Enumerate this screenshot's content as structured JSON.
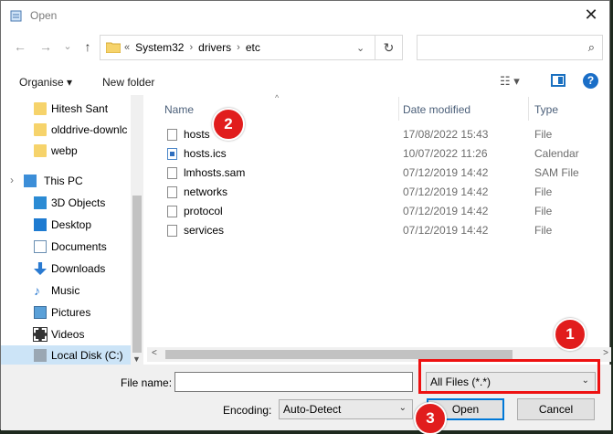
{
  "window": {
    "title": "Open",
    "close_glyph": "✕"
  },
  "nav": {
    "back": "←",
    "forward": "→",
    "dropdown": "⌄",
    "up": "↑"
  },
  "address": {
    "overflow": "«",
    "crumbs": [
      "System32",
      "drivers",
      "etc"
    ],
    "separator": "›",
    "dropdown": "⌄",
    "refresh": "↻"
  },
  "search": {
    "placeholder": "",
    "icon": "⌕"
  },
  "toolbar": {
    "organise": "Organise ▾",
    "new_folder": "New folder",
    "view": "☷ ▾",
    "help": "?"
  },
  "sidebar": {
    "items": [
      {
        "label": "Hitesh Sant",
        "icon": "folder-icon"
      },
      {
        "label": "olddrive-downlc",
        "icon": "folder-icon"
      },
      {
        "label": "webp",
        "icon": "folder-icon"
      },
      {
        "label": "This PC",
        "icon": "computer-icon"
      },
      {
        "label": "3D Objects",
        "icon": "cube-icon"
      },
      {
        "label": "Desktop",
        "icon": "desktop-icon"
      },
      {
        "label": "Documents",
        "icon": "documents-icon"
      },
      {
        "label": "Downloads",
        "icon": "download-icon"
      },
      {
        "label": "Music",
        "icon": "music-icon"
      },
      {
        "label": "Pictures",
        "icon": "pictures-icon"
      },
      {
        "label": "Videos",
        "icon": "videos-icon"
      },
      {
        "label": "Local Disk (C:)",
        "icon": "disk-icon"
      }
    ],
    "expand_glyph": "›",
    "scroll_down": "▼"
  },
  "columns": {
    "name": "Name",
    "date": "Date modified",
    "type": "Type",
    "sort_caret": "^"
  },
  "files": [
    {
      "name": "hosts",
      "date": "17/08/2022 15:43",
      "type": "File"
    },
    {
      "name": "hosts.ics",
      "date": "10/07/2022 11:26",
      "type": "Calendar"
    },
    {
      "name": "lmhosts.sam",
      "date": "07/12/2019 14:42",
      "type": "SAM File"
    },
    {
      "name": "networks",
      "date": "07/12/2019 14:42",
      "type": "File"
    },
    {
      "name": "protocol",
      "date": "07/12/2019 14:42",
      "type": "File"
    },
    {
      "name": "services",
      "date": "07/12/2019 14:42",
      "type": "File"
    }
  ],
  "hscroll": {
    "left": "<",
    "right": ">"
  },
  "bottom": {
    "file_name_label": "File name:",
    "file_name_value": "",
    "file_type": "All Files  (*.*)",
    "encoding_label": "Encoding:",
    "encoding_value": "Auto-Detect",
    "open": "Open",
    "cancel": "Cancel",
    "chevron": "⌄"
  },
  "annotations": {
    "badge_1": "1",
    "badge_2": "2",
    "badge_3": "3",
    "color": "#e11d1d"
  }
}
